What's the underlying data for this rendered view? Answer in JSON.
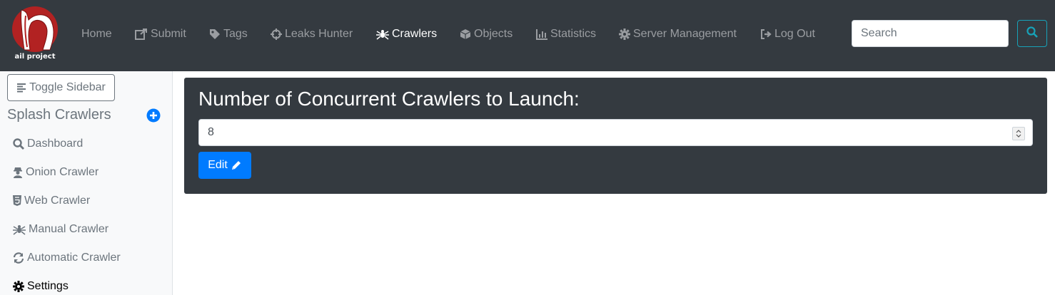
{
  "brand": {
    "logo_text": "ail project",
    "logo_color": "#b22222"
  },
  "nav": {
    "items": [
      {
        "label": "Home",
        "icon": "none"
      },
      {
        "label": "Submit",
        "icon": "external-link-icon"
      },
      {
        "label": "Tags",
        "icon": "tag-icon"
      },
      {
        "label": "Leaks Hunter",
        "icon": "crosshairs-icon"
      },
      {
        "label": "Crawlers",
        "icon": "spider-icon",
        "active": true
      },
      {
        "label": "Objects",
        "icon": "cube-icon"
      },
      {
        "label": "Statistics",
        "icon": "chart-bar-icon"
      },
      {
        "label": "Server Management",
        "icon": "cog-icon"
      },
      {
        "label": "Log Out",
        "icon": "sign-out-icon"
      }
    ],
    "search_placeholder": "Search",
    "search_value": ""
  },
  "sidebar": {
    "toggle_label": "Toggle Sidebar",
    "section_title": "Splash Crawlers",
    "items": [
      {
        "label": "Dashboard",
        "icon": "search-icon"
      },
      {
        "label": "Onion Crawler",
        "icon": "user-secret-icon"
      },
      {
        "label": "Web Crawler",
        "icon": "html5-icon"
      },
      {
        "label": "Manual Crawler",
        "icon": "spider-icon"
      },
      {
        "label": "Automatic Crawler",
        "icon": "sync-icon"
      },
      {
        "label": "Settings",
        "icon": "cog-icon",
        "active": true
      }
    ]
  },
  "main": {
    "card_title": "Number of Concurrent Crawlers to Launch:",
    "crawlers_value": "8",
    "edit_label": "Edit"
  },
  "colors": {
    "navbar_bg": "#343a40",
    "primary": "#007bff",
    "info": "#17a2b8",
    "add_icon": "#007bff"
  }
}
